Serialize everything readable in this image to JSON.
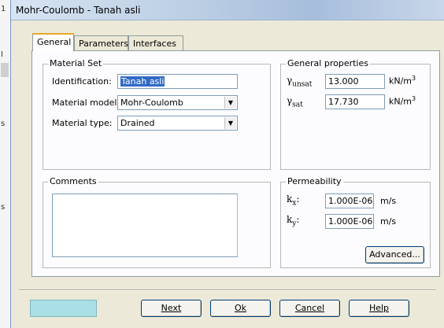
{
  "window": {
    "title": "Mohr-Coulomb - Tanah asli"
  },
  "tabs": [
    {
      "label": "General",
      "active": true
    },
    {
      "label": "Parameters",
      "active": false
    },
    {
      "label": "Interfaces",
      "active": false
    }
  ],
  "material_set": {
    "title": "Material Set",
    "identification_label": "Identification:",
    "identification_value": "Tanah asli",
    "model_label": "Material model:",
    "model_value": "Mohr-Coulomb",
    "type_label": "Material type:",
    "type_value": "Drained"
  },
  "general_properties": {
    "title": "General properties",
    "gamma_symbol": "γ",
    "gamma_unsat_sub": "unsat",
    "gamma_unsat_value": "13.000",
    "gamma_sat_sub": "sat",
    "gamma_sat_value": "17.730",
    "unit_base": "kN/m",
    "unit_exp": "3"
  },
  "comments": {
    "title": "Comments"
  },
  "permeability": {
    "title": "Permeability",
    "k_symbol": "k",
    "kx_sub": "x",
    "kx_value": "1.000E-06",
    "ky_sub": "y",
    "ky_value": "1.000E-06",
    "colon": ":",
    "unit": "m/s",
    "advanced_label": "Advanced..."
  },
  "buttons": {
    "next": "Next",
    "ok": "Ok",
    "cancel": "Cancel",
    "help": "Help"
  },
  "left_edge": {
    "glyph_1": "1",
    "glyph_2": "s",
    "glyph_3": "s",
    "glyph_4": "I"
  },
  "colors": {
    "accent_tab": "#e6a72a",
    "selection": "#316ac5",
    "cyan_box": "#aadfe6"
  }
}
